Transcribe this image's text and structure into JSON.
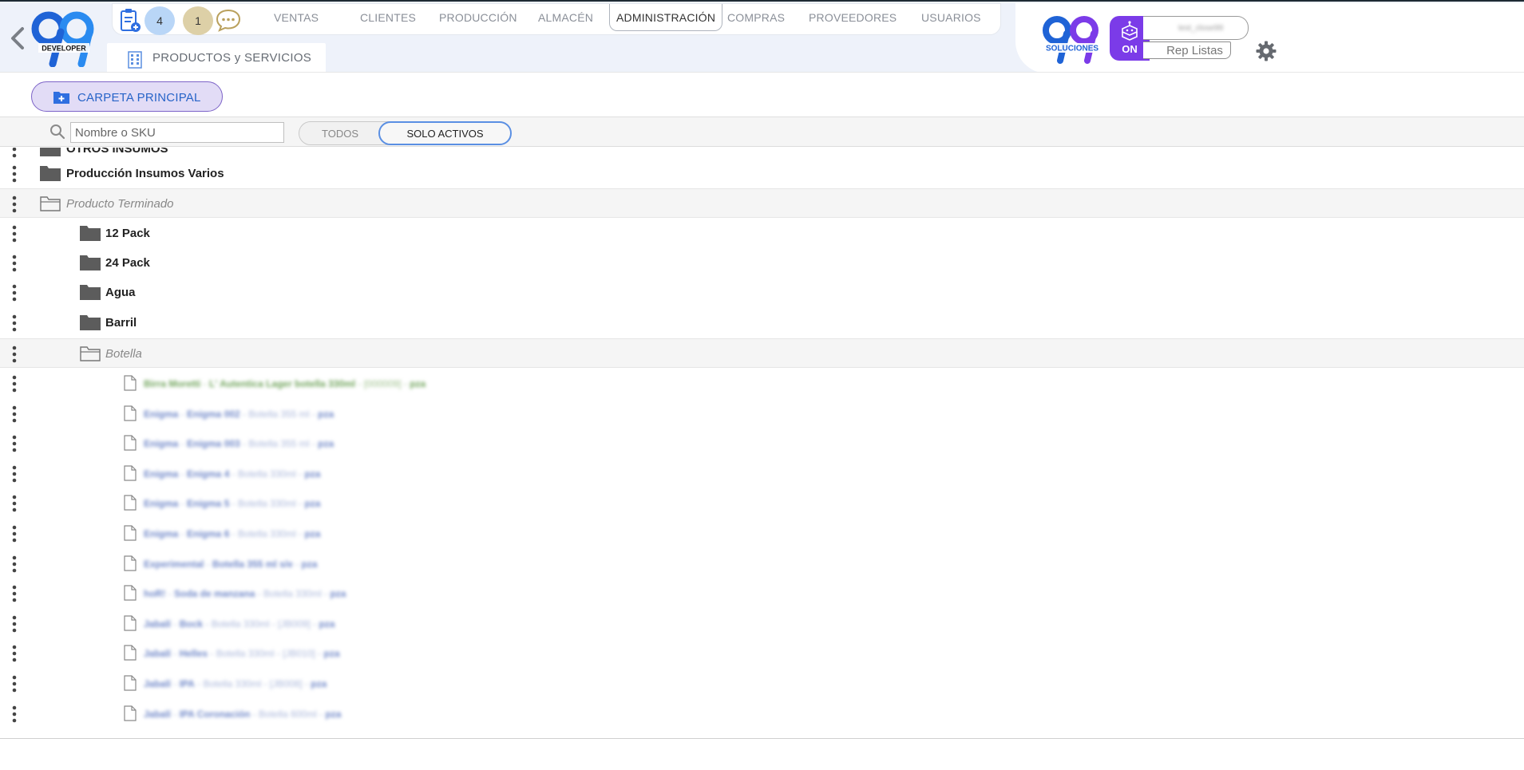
{
  "header": {
    "nav": {
      "badge_tasks_count": "4",
      "badge_messages_count": "1",
      "items": [
        {
          "label": "VENTAS"
        },
        {
          "label": "CLIENTES"
        },
        {
          "label": "PRODUCCIÓN"
        },
        {
          "label": "ALMACÉN"
        },
        {
          "label": "ADMINISTRACIÓN",
          "active": true
        },
        {
          "label": "COMPRAS"
        },
        {
          "label": "PROVEEDORES"
        },
        {
          "label": "USUARIOS"
        }
      ]
    },
    "tab_label": "PRODUCTOS y SERVICIOS",
    "on_label": "ON",
    "user_name": "test_close99",
    "rep_listas": "Rep Listas",
    "colors": {
      "brand_blue": "#1f63d6",
      "brand_purple": "#7b3be8",
      "header_bg": "#eef2fa"
    }
  },
  "toolbar": {
    "main_folder_label": "CARPETA PRINCIPAL",
    "search_placeholder": "Nombre o SKU",
    "filter_all": "TODOS",
    "filter_active": "SOLO ACTIVOS"
  },
  "tree": {
    "partial_top": "OTROS INSUMOS",
    "folders_top": [
      {
        "label": "Producción Insumos Varios"
      },
      {
        "label": "Producto Terminado",
        "open": true
      }
    ],
    "subfolders": [
      {
        "label": "12 Pack"
      },
      {
        "label": "24 Pack"
      },
      {
        "label": "Agua"
      },
      {
        "label": "Barril"
      },
      {
        "label": "Botella",
        "open": true
      }
    ],
    "items": [
      {
        "brand": "Birra Moretti",
        "name": "L' Autentica Lager botella 330ml",
        "detail": "[000009]",
        "unit": "pza",
        "color": "green"
      },
      {
        "brand": "Enigma",
        "name": "Enigma 002",
        "detail": "Botella 355 ml",
        "unit": "pza"
      },
      {
        "brand": "Enigma",
        "name": "Enigma 003",
        "detail": "Botella 355 ml",
        "unit": "pza"
      },
      {
        "brand": "Enigma",
        "name": "Enigma 4",
        "detail": "Botella 330ml",
        "unit": "pza"
      },
      {
        "brand": "Enigma",
        "name": "Enigma 5",
        "detail": "Botella 330ml",
        "unit": "pza"
      },
      {
        "brand": "Enigma",
        "name": "Enigma 6",
        "detail": "Botella 330ml",
        "unit": "pza"
      },
      {
        "brand": "Experimental",
        "name": "Botella 355 ml s/e",
        "detail": "",
        "unit": "pza"
      },
      {
        "brand": "hoR!",
        "name": "Soda de manzana",
        "detail": "Botella 330ml",
        "unit": "pza"
      },
      {
        "brand": "Jabalí",
        "name": "Bock",
        "detail": "Botella 330ml  -  [JB009]",
        "unit": "pza"
      },
      {
        "brand": "Jabalí",
        "name": "Helles",
        "detail": "Botella 330ml  -  [JB010]",
        "unit": "pza"
      },
      {
        "brand": "Jabalí",
        "name": "IPA",
        "detail": "Botella 330ml  -  [JB008]",
        "unit": "pza"
      },
      {
        "brand": "Jabalí",
        "name": "IPA Coronación",
        "detail": "Botella 600ml",
        "unit": "pza"
      }
    ]
  }
}
